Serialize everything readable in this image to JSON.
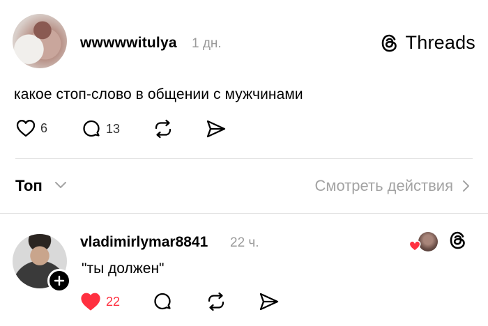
{
  "post": {
    "username": "wwwwwitulya",
    "time": "1 дн.",
    "text": "какое стоп-слово в общении с мужчинами",
    "likes": "6",
    "comments": "13"
  },
  "brand": {
    "name": "Threads"
  },
  "sort": {
    "label": "Топ",
    "activity_label": "Смотреть действия"
  },
  "reply": {
    "username": "vladimirlymar8841",
    "time": "22 ч.",
    "text": "\"ты должен\"",
    "likes": "22"
  },
  "colors": {
    "like_red": "#ff3040",
    "muted_gray": "#9a9a9a"
  }
}
